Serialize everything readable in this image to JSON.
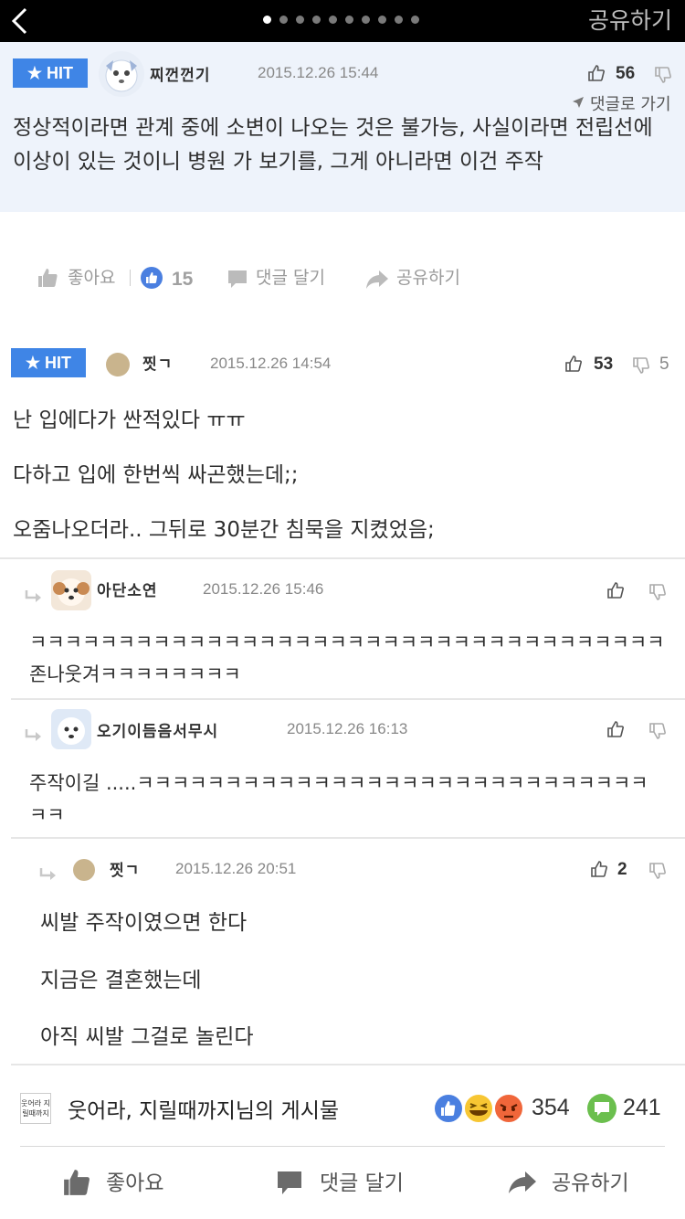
{
  "topbar": {
    "share_label": "공유하기",
    "page_dots": 10,
    "active_dot": 0
  },
  "comments": [
    {
      "badge": "★ HIT",
      "username": "찌껀껀기",
      "date": "2015.12.26 15:44",
      "likes": "56",
      "goto_label": "댓글로 가기",
      "text": "정상적이라면 관계 중에 소변이 나오는 것은 불가능, 사실이라면 전립선에 이상이 있는 것이니 병원 가 보기를, 그게 아니라면 이건 주작"
    },
    {
      "badge": "★ HIT",
      "username": "찟ㄱ",
      "date": "2015.12.26 14:54",
      "likes": "53",
      "dislikes": "5",
      "lines": [
        "난 입에다가 싼적있다 ㅠㅠ",
        "다하고 입에 한번씩 싸곤했는데;;",
        "오줌나오더라.. 그뒤로 30분간 침묵을 지켰었음;"
      ]
    }
  ],
  "action_row": {
    "like_label": "좋아요",
    "like_count": "15",
    "comment_label": "댓글 달기",
    "share_label": "공유하기"
  },
  "replies": [
    {
      "username": "아단소연",
      "date": "2015.12.26 15:46",
      "text": "ㅋㅋㅋㅋㅋㅋㅋㅋㅋㅋㅋㅋㅋㅋㅋㅋㅋㅋㅋㅋㅋㅋㅋㅋㅋㅋㅋㅋㅋㅋㅋㅋㅋㅋㅋㅋ존나웃겨ㅋㅋㅋㅋㅋㅋㅋㅋ"
    },
    {
      "username": "오기이듬음서무시",
      "date": "2015.12.26 16:13",
      "text": "주작이길 .....ㅋㅋㅋㅋㅋㅋㅋㅋㅋㅋㅋㅋㅋㅋㅋㅋㅋㅋㅋㅋㅋㅋㅋㅋㅋㅋㅋㅋㅋㅋㅋ"
    },
    {
      "username": "찟ㄱ",
      "date": "2015.12.26 20:51",
      "likes": "2",
      "lines": [
        "씨발 주작이였으면 한다",
        "지금은 결혼했는데",
        "아직 씨발 그걸로 놀린다"
      ]
    }
  ],
  "bottom": {
    "page_logo_text": "웃어라 지릴때까지",
    "page_name": "웃어라, 지릴때까지님의 게시물",
    "reaction_count": "354",
    "comment_count": "241",
    "like_label": "좋아요",
    "comment_label": "댓글 달기",
    "share_label": "공유하기",
    "colors": {
      "like_blue": "#4a7fe0",
      "haha_yellow": "#f7c633",
      "angry_orange": "#f0663a",
      "comment_green": "#6bbf4e"
    }
  },
  "colors": {
    "hit_badge": "#3f85e6",
    "hit_highlight_bg": "#eef3fb",
    "topbar_bg": "#000000"
  }
}
